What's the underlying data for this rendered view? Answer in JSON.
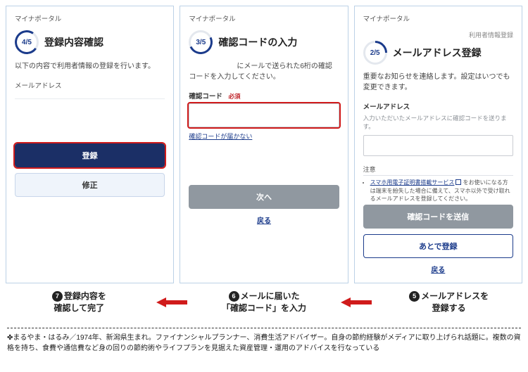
{
  "screens": {
    "left": {
      "app_title": "マイナポータル",
      "step_num": "4/5",
      "step_title": "登録内容確認",
      "desc": "以下の内容で利用者情報の登録を行います。",
      "field_email_label": "メールアドレス",
      "btn_register": "登録",
      "btn_fix": "修正"
    },
    "mid": {
      "app_title": "マイナポータル",
      "step_num": "3/5",
      "step_title": "確認コードの入力",
      "desc_pre": "",
      "desc": "にメールで送られた6桁の確認コードを入力してください。",
      "code_label": "確認コード",
      "code_required": "必須",
      "link_notreceived": "確認コードが届かない",
      "btn_next": "次へ",
      "link_back": "戻る"
    },
    "right": {
      "app_title": "マイナポータル",
      "breadcrumb": "利用者情報登録",
      "step_num": "2/5",
      "step_title": "メールアドレス登録",
      "desc": "重要なお知らせを連絡します。設定はいつでも変更できます。",
      "field_email_label": "メールアドレス",
      "field_email_help": "入力いただいたメールアドレスに確認コードを送ります。",
      "note_title": "注意",
      "note_link_label": "スマホ用電子証明書搭載サービス",
      "note_rest": " をお使いになる方は端末を紛失した場合に備えて、スマホ以外で受け取れるメールアドレスを登録してください。",
      "btn_send": "確認コードを送信",
      "btn_later": "あとで登録",
      "link_back": "戻る"
    }
  },
  "captions": {
    "c7": {
      "num": "7",
      "line1": "登録内容を",
      "line2": "確認して完了"
    },
    "c6": {
      "num": "6",
      "line1": "メールに届いた",
      "line2": "「確認コード」を入力"
    },
    "c5": {
      "num": "5",
      "line1": "メールアドレスを",
      "line2": "登録する"
    }
  },
  "bio": {
    "diamond": "✤",
    "text": "まるやま・はるみ／1974年、新潟県生まれ。ファイナンシャルプランナー、消費生活アドバイザー。自身の節約経験がメディアに取り上げられ話題に。複数の資格を持ち、食費や通信費など身の回りの節約術やライフプランを見据えた資産管理・運用のアドバイスを行なっている"
  }
}
